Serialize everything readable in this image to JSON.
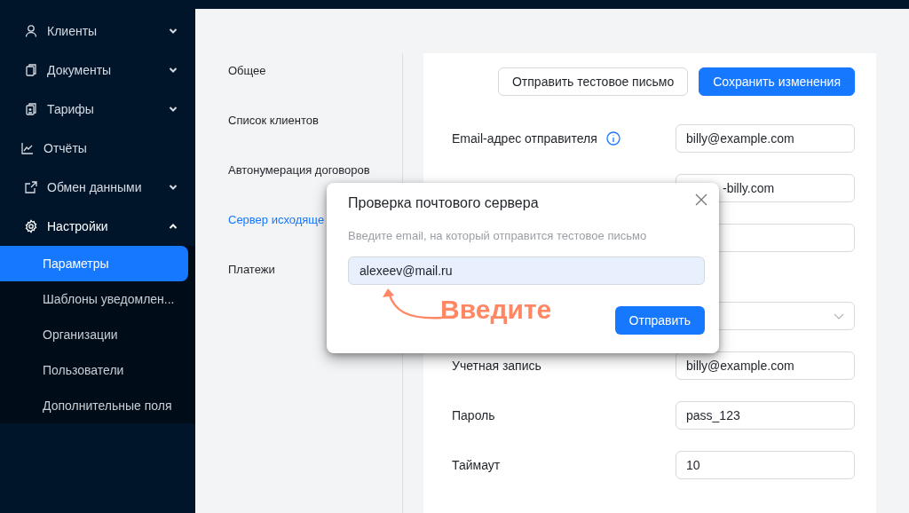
{
  "sidebar": {
    "items": [
      {
        "label": "Клиенты",
        "kind": "group",
        "expanded": false
      },
      {
        "label": "Документы",
        "kind": "group",
        "expanded": false
      },
      {
        "label": "Тарифы",
        "kind": "group",
        "expanded": false
      },
      {
        "label": "Отчёты",
        "kind": "link"
      },
      {
        "label": "Обмен данными",
        "kind": "group",
        "expanded": false
      },
      {
        "label": "Настройки",
        "kind": "group",
        "expanded": true,
        "children": [
          {
            "label": "Параметры",
            "selected": true
          },
          {
            "label": "Шаблоны уведомлен...",
            "selected": false
          },
          {
            "label": "Организации",
            "selected": false
          },
          {
            "label": "Пользователи",
            "selected": false
          },
          {
            "label": "Дополнительные поля",
            "selected": false
          }
        ]
      }
    ]
  },
  "settings_nav": [
    {
      "label": "Общее",
      "selected": false
    },
    {
      "label": "Список клиентов",
      "selected": false
    },
    {
      "label": "Автонумерация договоров",
      "selected": false
    },
    {
      "label": "Сервер исходяще",
      "selected": true
    },
    {
      "label": "Платежи",
      "selected": false
    }
  ],
  "toolbar": [
    {
      "label": "Отправить тестовое письмо",
      "kind": "default"
    },
    {
      "label": "Сохранить изменения",
      "kind": "primary"
    }
  ],
  "form": [
    {
      "label": "Email-адрес отправителя",
      "info": true,
      "kind": "text",
      "value": "billy@example.com"
    },
    {
      "kind": "text",
      "covered": true,
      "value": "-billy.com"
    },
    {
      "kind": "text",
      "covered": true
    },
    {
      "kind": "select",
      "covered": true
    },
    {
      "label": "Учетная запись",
      "kind": "text",
      "value": "billy@example.com"
    },
    {
      "label": "Пароль",
      "kind": "text",
      "value": "pass_123"
    },
    {
      "label": "Таймаут",
      "kind": "text",
      "value": "10"
    }
  ],
  "modal": {
    "title": "Проверка почтового сервера",
    "hint": "Введите email, на который отправится тестовое письмо",
    "value": "alexeev@mail.ru",
    "button": "Отправить",
    "annotation": "Введите"
  }
}
